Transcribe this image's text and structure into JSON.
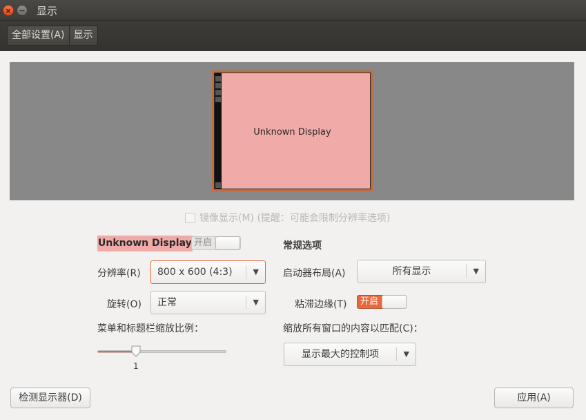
{
  "window": {
    "title": "显示"
  },
  "toolbar": {
    "crumbs": [
      "全部设置(A)",
      "显示"
    ]
  },
  "preview": {
    "monitor_label": "Unknown Display"
  },
  "mirror": {
    "label": "镜像显示(M) (提醒：可能会限制分辨率选项)",
    "checked": false
  },
  "display": {
    "name": "Unknown Display",
    "enabled_toggle": {
      "label": "开启",
      "on": false
    },
    "resolution": {
      "label": "分辨率(R)",
      "value": "800 x 600 (4:3)"
    },
    "rotation": {
      "label": "旋转(O)",
      "value": "正常"
    },
    "scale": {
      "label": "菜单和标题栏缩放比例：",
      "value": 0.3,
      "tick_label": "1"
    }
  },
  "general": {
    "heading": "常规选项",
    "launcher": {
      "label": "启动器布局(A)",
      "value": "所有显示"
    },
    "sticky_edges": {
      "label": "粘滞边缘(T)",
      "toggle_label": "开启",
      "on": true
    },
    "scale_windows": {
      "label": "缩放所有窗口的内容以匹配(C)：",
      "value": "显示最大的控制项"
    }
  },
  "buttons": {
    "detect": "检测显示器(D)",
    "apply": "应用(A)"
  },
  "colors": {
    "accent": "#e9673d",
    "monitor": "#f0aaa8",
    "titlebar": "#3c3b37"
  }
}
